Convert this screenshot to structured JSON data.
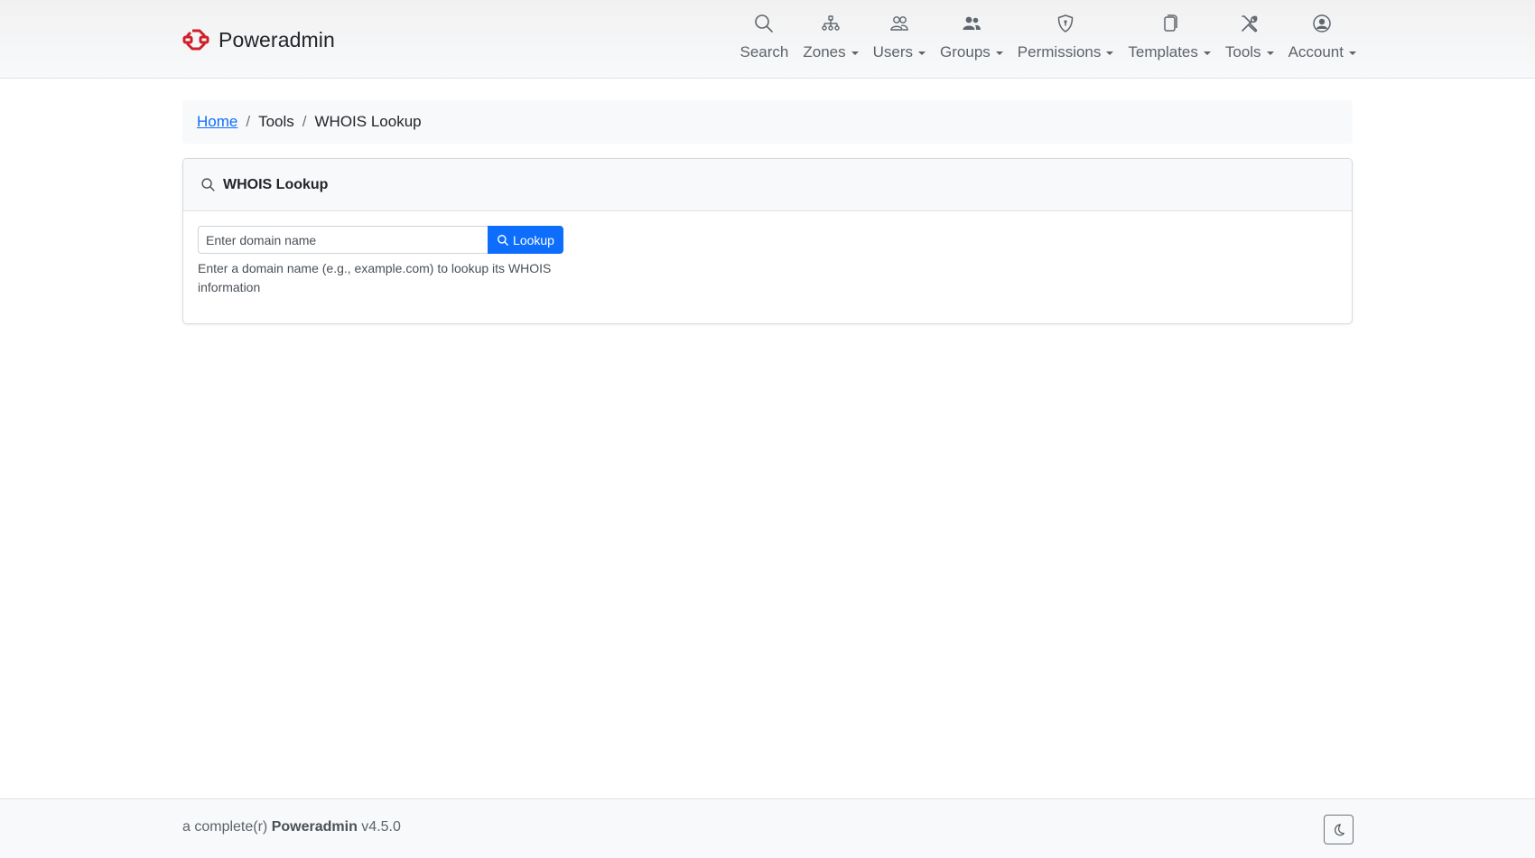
{
  "brand": {
    "name": "Poweradmin",
    "logo_icon": "poweradmin-logo-icon",
    "accent": "#d01f2a"
  },
  "nav": {
    "items": [
      {
        "label": "Search",
        "icon": "search-icon",
        "dropdown": false
      },
      {
        "label": "Zones",
        "icon": "zones-icon",
        "dropdown": true
      },
      {
        "label": "Users",
        "icon": "users-icon",
        "dropdown": true
      },
      {
        "label": "Groups",
        "icon": "groups-icon",
        "dropdown": true
      },
      {
        "label": "Permissions",
        "icon": "shield-icon",
        "dropdown": true
      },
      {
        "label": "Templates",
        "icon": "templates-icon",
        "dropdown": true
      },
      {
        "label": "Tools",
        "icon": "tools-icon",
        "dropdown": true
      },
      {
        "label": "Account",
        "icon": "account-icon",
        "dropdown": true
      }
    ]
  },
  "breadcrumb": {
    "home": "Home",
    "separator": "/",
    "tools": "Tools",
    "current": "WHOIS Lookup"
  },
  "card": {
    "title": "WHOIS Lookup",
    "title_icon": "search-icon",
    "domain_input": {
      "value": "",
      "placeholder": "Enter domain name"
    },
    "lookup_button": "Lookup",
    "help_text": "Enter a domain name (e.g., example.com) to lookup its WHOIS information"
  },
  "footer": {
    "prefix": "a complete(r)",
    "app_name": "Poweradmin",
    "version": "v4.5.0",
    "theme_toggle_icon": "moon-icon"
  },
  "colors": {
    "primary": "#0d6efd",
    "link": "#0d6efd",
    "brand_red": "#d01f2a"
  }
}
